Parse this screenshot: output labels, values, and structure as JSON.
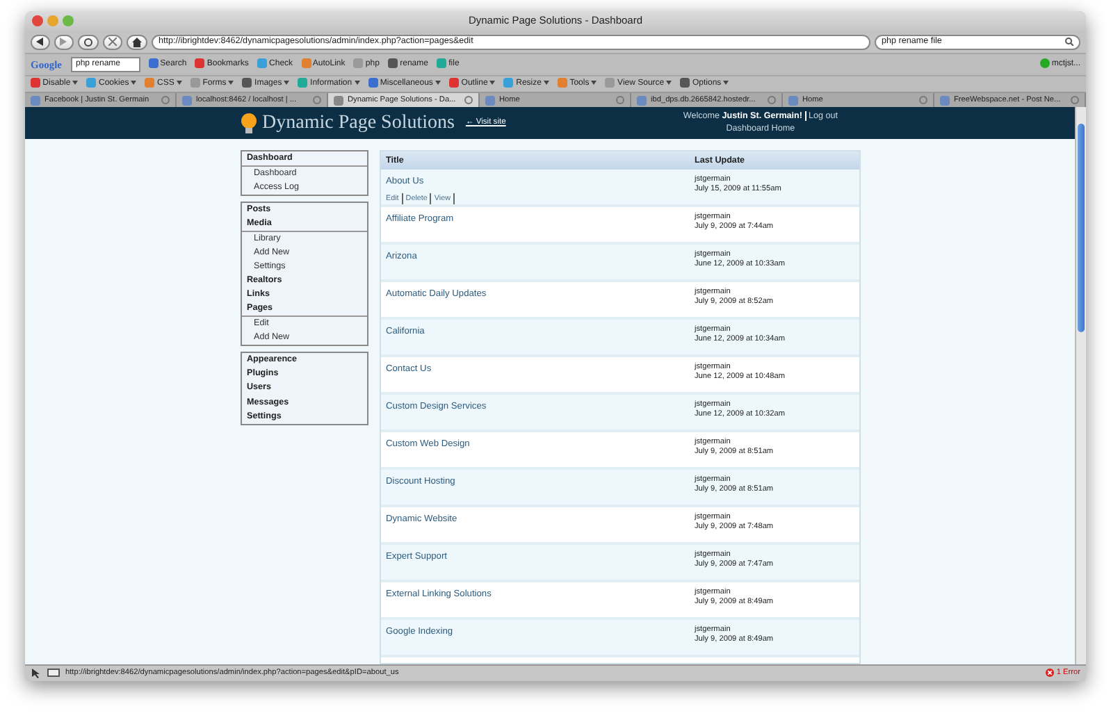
{
  "window": {
    "title": "Dynamic Page Solutions - Dashboard"
  },
  "nav_toolbar": {
    "url": "http://ibrightdev:8462/dynamicpagesolutions/admin/index.php?action=pages&edit",
    "search_value": "php rename file"
  },
  "google_toolbar": {
    "logo": "Google",
    "query": "php rename",
    "items": [
      "Search",
      "Bookmarks",
      "Check",
      "AutoLink",
      "php",
      "rename",
      "file"
    ],
    "account": "mctjst..."
  },
  "developer_toolbar": {
    "items": [
      "Disable",
      "Cookies",
      "CSS",
      "Forms",
      "Images",
      "Information",
      "Miscellaneous",
      "Outline",
      "Resize",
      "Tools",
      "View Source",
      "Options"
    ]
  },
  "tabs": [
    {
      "label": "Facebook | Justin St. Germain",
      "selected": false
    },
    {
      "label": "localhost:8462 / localhost | ...",
      "selected": false
    },
    {
      "label": "Dynamic Page Solutions - Da...",
      "selected": true
    },
    {
      "label": "Home",
      "selected": false
    },
    {
      "label": "ibd_dps.db.2665842.hostedr...",
      "selected": false
    },
    {
      "label": "Home",
      "selected": false
    },
    {
      "label": "FreeWebspace.net - Post Ne...",
      "selected": false
    }
  ],
  "header": {
    "site_name": "Dynamic Page Solutions",
    "visit_site": "← Visit site",
    "welcome": "Welcome",
    "user": "Justin St. Germain!",
    "logout": "Log out",
    "dashboard_home": "Dashboard Home"
  },
  "sidebar": {
    "groups": [
      {
        "items": [
          {
            "label": "Dashboard",
            "children": [
              {
                "label": "Dashboard"
              },
              {
                "label": "Access Log"
              }
            ]
          }
        ]
      },
      {
        "items": [
          {
            "label": "Posts"
          },
          {
            "label": "Media",
            "children": [
              {
                "label": "Library"
              },
              {
                "label": "Add New"
              },
              {
                "label": "Settings"
              }
            ]
          },
          {
            "label": "Realtors"
          },
          {
            "label": "Links"
          },
          {
            "label": "Pages",
            "children": [
              {
                "label": "Edit"
              },
              {
                "label": "Add New"
              }
            ]
          }
        ]
      },
      {
        "items": [
          {
            "label": "Appearence"
          },
          {
            "label": "Plugins"
          },
          {
            "label": "Users"
          },
          {
            "label": "Messages"
          },
          {
            "label": "Settings"
          }
        ]
      }
    ]
  },
  "table": {
    "columns": [
      "Title",
      "Last Update"
    ],
    "rows": [
      {
        "title": "About Us",
        "user": "jstgermain",
        "date": "July 15, 2009 at 11:55am",
        "actions": [
          "Edit",
          "Delete",
          "View"
        ]
      },
      {
        "title": "Affiliate Program",
        "user": "jstgermain",
        "date": "July 9, 2009 at 7:44am"
      },
      {
        "title": "Arizona",
        "user": "jstgermain",
        "date": "June 12, 2009 at 10:33am"
      },
      {
        "title": "Automatic Daily Updates",
        "user": "jstgermain",
        "date": "July 9, 2009 at 8:52am"
      },
      {
        "title": "California",
        "user": "jstgermain",
        "date": "June 12, 2009 at 10:34am"
      },
      {
        "title": "Contact Us",
        "user": "jstgermain",
        "date": "June 12, 2009 at 10:48am"
      },
      {
        "title": "Custom Design Services",
        "user": "jstgermain",
        "date": "June 12, 2009 at 10:32am"
      },
      {
        "title": "Custom Web Design",
        "user": "jstgermain",
        "date": "July 9, 2009 at 8:51am"
      },
      {
        "title": "Discount Hosting",
        "user": "jstgermain",
        "date": "July 9, 2009 at 8:51am"
      },
      {
        "title": "Dynamic Website",
        "user": "jstgermain",
        "date": "July 9, 2009 at 7:48am"
      },
      {
        "title": "Expert Support",
        "user": "jstgermain",
        "date": "July 9, 2009 at 7:47am"
      },
      {
        "title": "External Linking Solutions",
        "user": "jstgermain",
        "date": "July 9, 2009 at 8:49am"
      },
      {
        "title": "Google Indexing",
        "user": "jstgermain",
        "date": "July 9, 2009 at 8:49am"
      }
    ]
  },
  "status_bar": {
    "url": "http://ibrightdev:8462/dynamicpagesolutions/admin/index.php?action=pages&edit&pID=about_us",
    "error": "1 Error"
  }
}
